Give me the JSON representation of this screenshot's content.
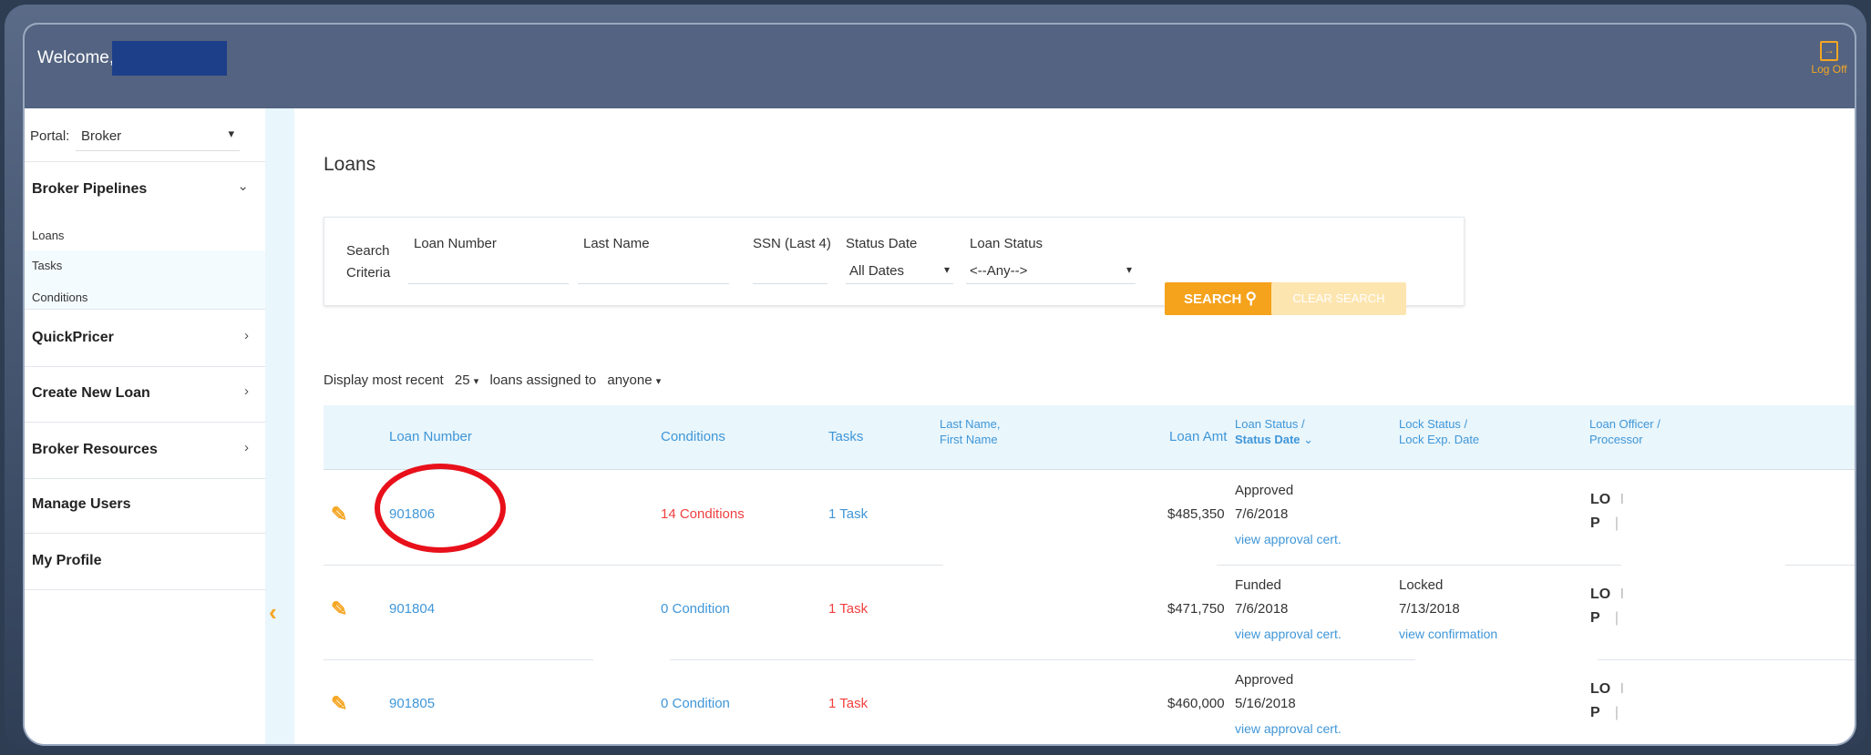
{
  "header": {
    "welcome": "Welcome, I",
    "logoff_label": "Log Off",
    "logoff_icon": "exit-icon"
  },
  "sidebar": {
    "portal_label": "Portal:",
    "portal_value": "Broker",
    "menus": [
      {
        "label": "Broker Pipelines",
        "chevron": "⌄"
      },
      {
        "label": "QuickPricer",
        "chevron": "›"
      },
      {
        "label": "Create New Loan",
        "chevron": "›"
      },
      {
        "label": "Broker Resources",
        "chevron": "›"
      },
      {
        "label": "Manage Users"
      },
      {
        "label": "My Profile"
      }
    ],
    "subitems": [
      "Loans",
      "Tasks",
      "Conditions"
    ],
    "collapse_icon": "‹"
  },
  "main": {
    "title": "Loans",
    "search": {
      "criteria_line1": "Search",
      "criteria_line2": "Criteria",
      "loan_number_label": "Loan Number",
      "last_name_label": "Last Name",
      "ssn_label": "SSN (Last 4)",
      "status_date_label": "Status Date",
      "status_date_value": "All Dates",
      "loan_status_label": "Loan Status",
      "loan_status_value": "<--Any-->",
      "search_button": "SEARCH",
      "clear_button": "CLEAR SEARCH"
    },
    "display": {
      "prefix": "Display most recent",
      "count": "25",
      "middle": "loans assigned to",
      "assignee": "anyone"
    },
    "columns": {
      "loan_number": "Loan Number",
      "conditions": "Conditions",
      "tasks": "Tasks",
      "name_line1": "Last Name,",
      "name_line2": "First Name",
      "loan_amt": "Loan Amt",
      "status_line1": "Loan Status /",
      "status_line2": "Status Date",
      "lock_line1": "Lock Status /",
      "lock_line2": "Lock Exp. Date",
      "officer_line1": "Loan Officer /",
      "officer_line2": "Processor"
    },
    "rows": [
      {
        "loan_number": "901806",
        "conditions": "14 Conditions",
        "tasks": "1 Task",
        "amount": "$485,350",
        "status": "Approved",
        "status_date": "7/6/2018",
        "status_link": "view approval cert.",
        "lock_status": "",
        "lock_date": "",
        "lock_link": "",
        "lo": "LO",
        "p": "P",
        "lo_mark": "I",
        "p_mark": "|"
      },
      {
        "loan_number": "901804",
        "conditions": "0 Condition",
        "tasks": "1 Task",
        "amount": "$471,750",
        "status": "Funded",
        "status_date": "7/6/2018",
        "status_link": "view approval cert.",
        "lock_status": "Locked",
        "lock_date": "7/13/2018",
        "lock_link": "view confirmation",
        "lo": "LO",
        "p": "P",
        "lo_mark": "I",
        "p_mark": "|"
      },
      {
        "loan_number": "901805",
        "conditions": "0 Condition",
        "tasks": "1 Task",
        "amount": "$460,000",
        "status": "Approved",
        "status_date": "5/16/2018",
        "status_link": "view approval cert.",
        "lock_status": "",
        "lock_date": "",
        "lock_link": "",
        "lo": "LO",
        "p": "P",
        "lo_mark": "I",
        "p_mark": "|"
      }
    ],
    "icons": {
      "edit": "pencil-icon",
      "search": "search-icon",
      "sort": "sort-down-icon"
    }
  },
  "colors": {
    "topbar": "#536381",
    "accent": "#f5a21c",
    "link": "#3f96d8",
    "alert": "#f04040",
    "highlight": "#e8101a"
  }
}
